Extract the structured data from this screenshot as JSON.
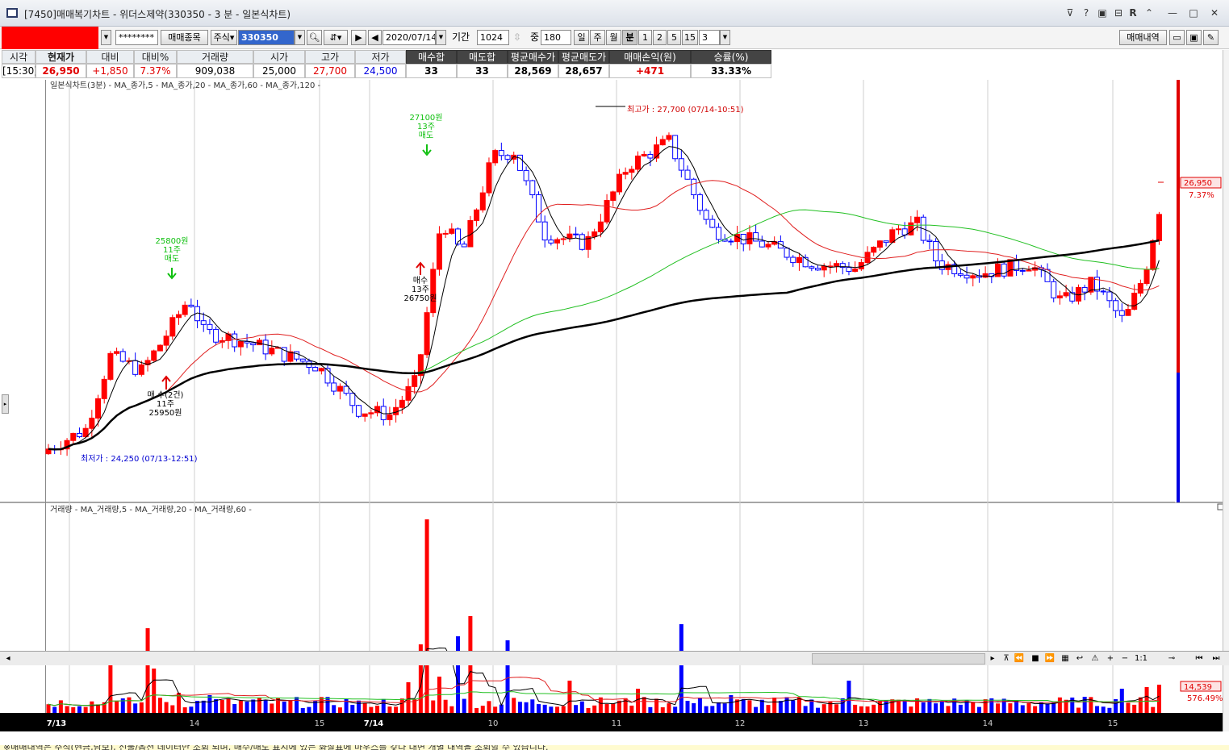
{
  "window": {
    "title": "[7450]매매복기차트 - 위더스제약(330350 - 3 분 - 일본식차트)"
  },
  "titlebar_controls": [
    "⊽",
    "?",
    "▣",
    "⊟",
    "R",
    "⌃",
    "—",
    "□",
    "✕"
  ],
  "toolbar": {
    "password_mask": "********",
    "trade_items_button": "매매종목",
    "type_label": "주식",
    "stock_code": "330350",
    "date": "2020/07/14",
    "period_label": "기간",
    "period_value": "1024",
    "count_label": "중",
    "count_value": "180",
    "unit_buttons": [
      "일",
      "주",
      "월",
      "분",
      "1",
      "2",
      "5",
      "15"
    ],
    "active_unit": "분",
    "minute_value": "3",
    "trade_history_button": "매매내역"
  },
  "info": {
    "headers": [
      "시각",
      "현재가",
      "대비",
      "대비%",
      "거래량",
      "시가",
      "고가",
      "저가",
      "매수합",
      "매도합",
      "평균매수가",
      "평균매도가",
      "매매손익(원)",
      "승률(%)"
    ],
    "values": [
      "[15:30]",
      "26,950",
      "+1,850",
      "7.37%",
      "909,038",
      "25,000",
      "27,700",
      "24,500",
      "33",
      "33",
      "28,569",
      "28,657",
      "+471",
      "33.33%"
    ]
  },
  "price_panel": {
    "legend": "일본식차트(3분) - MA_종가,5 - MA_종가,20 - MA_종가,60 - MA_종가,120 -",
    "current_price_label": "26,950",
    "current_change_label": "7.37%",
    "annotations": {
      "high": "최고가 : 27,700 (07/14-10:51)",
      "low": "최저가 : 24,250 (07/13-12:51)",
      "sell1": [
        "25800원",
        "11주",
        "매도"
      ],
      "buy1": [
        "매 수(2건)",
        "11주",
        "25950원"
      ],
      "sell2": [
        "27100원",
        "13주",
        "매도"
      ],
      "buy2": [
        "매수",
        "13주",
        "26750원"
      ]
    }
  },
  "volume_panel": {
    "legend": "거래량 - MA_거래량,5 - MA_거래량,20 - MA_거래량,60 -",
    "current_volume_label": "14,539",
    "volume_pct_label": "576.49%"
  },
  "time_axis": {
    "labels": [
      "7/13",
      "14",
      "15",
      "7/14",
      "10",
      "11",
      "12",
      "13",
      "14",
      "15"
    ]
  },
  "status": "※매매내역은 주식(현금,담보), 선물/옵션 데이터만 조회 되며, 매수/매도 표시에 있는 화살표에 마우스를 갖다 대면 개별 내역을 조회할 수 있습니다.",
  "colors": {
    "up": "#ff0000",
    "down": "#0000ff",
    "ma5": "#000000",
    "ma20": "#e02020",
    "ma60": "#22c022",
    "ma120": "#000000"
  },
  "icons": [
    "app-icon",
    "search-icon",
    "arrow-right-icon",
    "arrow-left-icon",
    "folder-icon",
    "save-icon",
    "settings-icon",
    "zoom-in-icon",
    "zoom-out-icon"
  ],
  "chart_data": {
    "type": "candlestick",
    "title": "일본식차트(3분)",
    "xlabel": "",
    "ylabel": "",
    "ylim": [
      24000,
      28000
    ],
    "session_labels": [
      "7/13",
      "14",
      "15",
      "7/14",
      "10",
      "11",
      "12",
      "13",
      "14",
      "15"
    ],
    "ohlc_anchor_points": [
      {
        "time": "07/13 start",
        "price": 24400
      },
      {
        "time": "07/13 13:45",
        "price": 25900
      },
      {
        "time": "07/13 14:00",
        "price": 25450
      },
      {
        "time": "07/13 15:20",
        "price": 24700
      },
      {
        "time": "07/14 09:15",
        "price": 26700
      },
      {
        "time": "07/14 09:50",
        "price": 27450
      },
      {
        "time": "07/14 10:51",
        "price": 27700
      },
      {
        "time": "07/14 12:50",
        "price": 26350
      },
      {
        "time": "07/14 13:00",
        "price": 26900
      },
      {
        "time": "07/14 14:30",
        "price": 26050
      },
      {
        "time": "07/14 15:15",
        "price": 25750
      },
      {
        "time": "07/14 15:30",
        "price": 26950
      }
    ],
    "trades": [
      {
        "side": "매도",
        "price": 25800,
        "qty": 11
      },
      {
        "side": "매수",
        "price": 25950,
        "qty": 11,
        "count": 2
      },
      {
        "side": "매도",
        "price": 27100,
        "qty": 13
      },
      {
        "side": "매수",
        "price": 26750,
        "qty": 13
      }
    ],
    "series": [
      {
        "name": "MA_종가,5"
      },
      {
        "name": "MA_종가,20"
      },
      {
        "name": "MA_종가,60"
      },
      {
        "name": "MA_종가,120"
      }
    ],
    "volume_series": [
      {
        "name": "MA_거래량,5"
      },
      {
        "name": "MA_거래량,20"
      },
      {
        "name": "MA_거래량,60"
      }
    ],
    "last_volume": 14539
  }
}
